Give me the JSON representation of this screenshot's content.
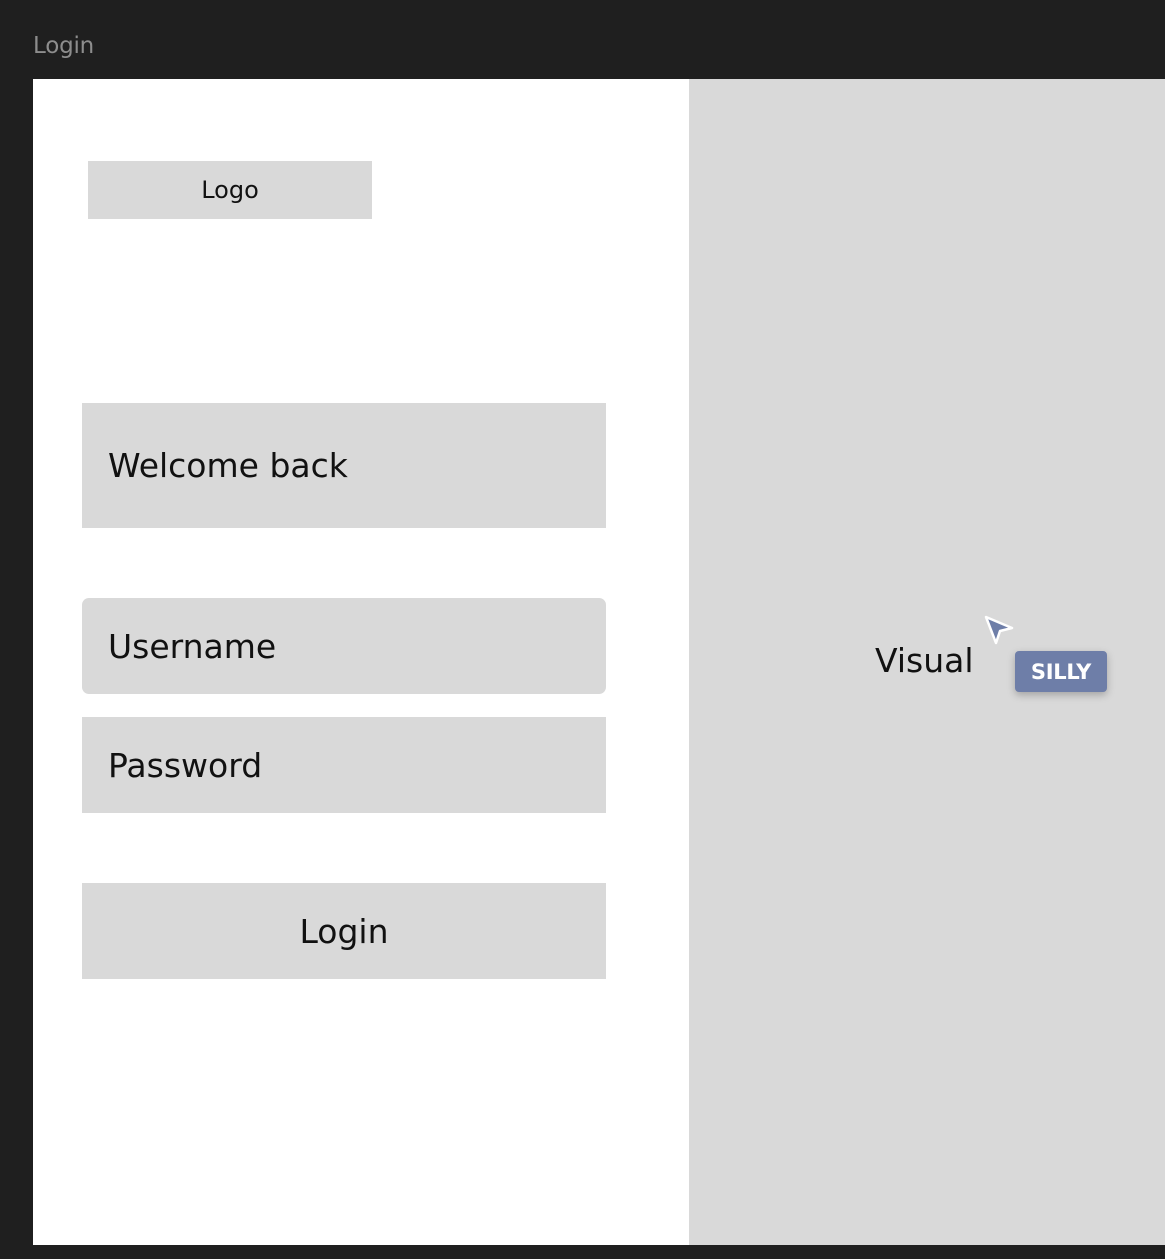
{
  "window": {
    "frame_title": "Login"
  },
  "header": {
    "logo_label": "Logo"
  },
  "form": {
    "welcome_text": "Welcome back",
    "username_placeholder": "Username",
    "password_placeholder": "Password",
    "login_label": "Login"
  },
  "visual_panel": {
    "label": "Visual",
    "cursor_tag": "SILLY"
  },
  "icons": {
    "cursor": "cursor-arrow-icon"
  },
  "colors": {
    "background": "#1f1f1f",
    "frame": "#ffffff",
    "placeholder_box": "#d9d9d9",
    "cursor_tag": "#6e7ea8",
    "frame_title": "#8d8d8d"
  }
}
